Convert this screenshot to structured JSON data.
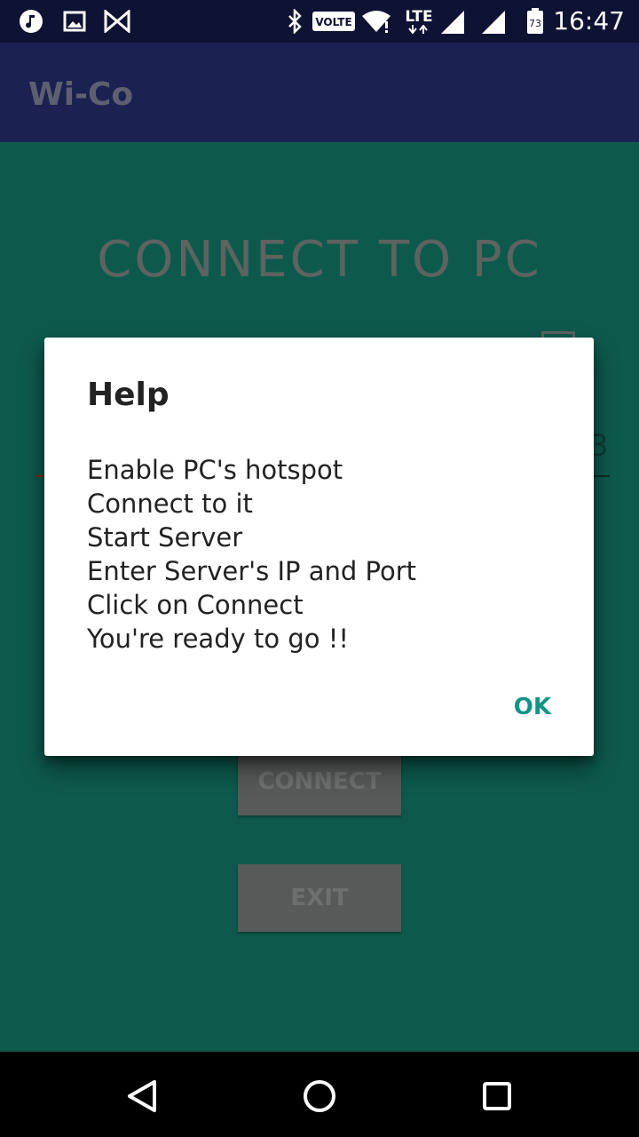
{
  "status_bar": {
    "time": "16:47",
    "network": "LTE",
    "volte": "VOLTE",
    "battery_level": "73",
    "icons": [
      "music-icon",
      "gallery-icon",
      "app-icon",
      "bluetooth-icon",
      "volte-icon",
      "wifi-icon",
      "lte-icon",
      "signal-icon",
      "signal-icon",
      "battery-icon"
    ]
  },
  "app_bar": {
    "title": "Wi-Co"
  },
  "main": {
    "heading": "CONNECT  TO  PC",
    "field_partial_text": "3",
    "connect_label": "CONNECT",
    "exit_label": "EXIT"
  },
  "dialog": {
    "title": "Help",
    "lines": [
      "Enable PC's hotspot",
      "Connect to it",
      "Start Server",
      "Enter Server's IP and Port",
      "Click on Connect",
      "You're ready to go !!"
    ],
    "ok_label": "OK"
  },
  "colors": {
    "status_bar": "#0e1233",
    "app_bar": "#1b2150",
    "content_bg": "#0d5a4d",
    "accent": "#149488"
  }
}
